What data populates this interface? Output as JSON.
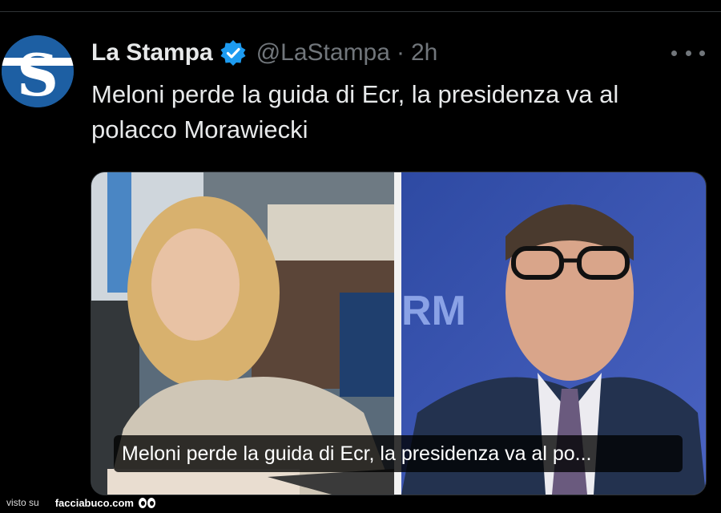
{
  "tweet": {
    "author_name": "La Stampa",
    "handle": "@LaStampa",
    "separator": "·",
    "time": "2h",
    "text": "Meloni perde la guida di Ecr, la presidenza va al polacco Morawiecki",
    "avatar_letter": "S",
    "icons": {
      "verified": "verified-badge-icon",
      "more": "more-options-icon"
    }
  },
  "media": {
    "caption": "Meloni perde la guida di Ecr, la presidenza va al po...",
    "background_sign_text": "RM"
  },
  "footer": {
    "visto_label": "visto su",
    "site_label": "facciabuco.com"
  },
  "colors": {
    "background": "#000000",
    "text_primary": "#e7e9ea",
    "text_secondary": "#71767b",
    "verified_blue": "#1d9bf0",
    "avatar_blue": "#1d5fa3"
  }
}
